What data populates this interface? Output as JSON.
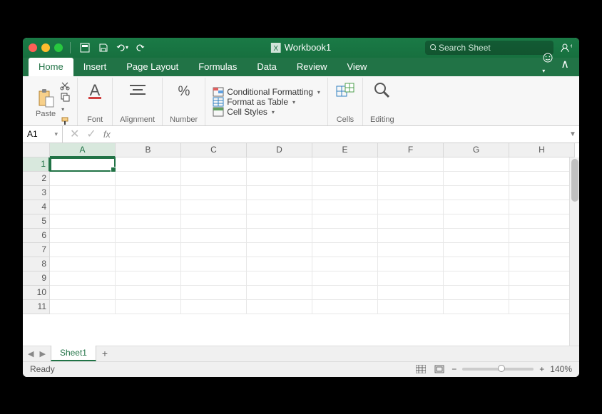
{
  "titlebar": {
    "title": "Workbook1",
    "search_placeholder": "Search Sheet"
  },
  "tabs": [
    "Home",
    "Insert",
    "Page Layout",
    "Formulas",
    "Data",
    "Review",
    "View"
  ],
  "active_tab": "Home",
  "ribbon": {
    "paste": "Paste",
    "font": "Font",
    "alignment": "Alignment",
    "number": "Number",
    "cond_fmt": "Conditional Formatting",
    "as_table": "Format as Table",
    "cell_styles": "Cell Styles",
    "cells": "Cells",
    "editing": "Editing"
  },
  "namebox": "A1",
  "formula": "",
  "columns": [
    "A",
    "B",
    "C",
    "D",
    "E",
    "F",
    "G",
    "H"
  ],
  "rows": [
    1,
    2,
    3,
    4,
    5,
    6,
    7,
    8,
    9,
    10,
    11
  ],
  "active_cell": "A1",
  "sheets": [
    "Sheet1"
  ],
  "status": {
    "ready": "Ready",
    "zoom": "140%"
  }
}
